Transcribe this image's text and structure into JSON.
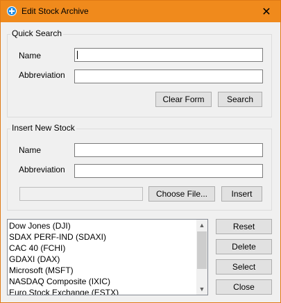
{
  "window": {
    "title": "Edit Stock Archive",
    "close_glyph": "✕",
    "icon": "add-circle-icon",
    "accent": "#f08a1c"
  },
  "quick_search": {
    "title": "Quick Search",
    "name_label": "Name",
    "name_value": "",
    "abbreviation_label": "Abbreviation",
    "abbreviation_value": "",
    "clear_label": "Clear Form",
    "search_label": "Search"
  },
  "insert_stock": {
    "title": "Insert New Stock",
    "name_label": "Name",
    "name_value": "",
    "abbreviation_label": "Abbreviation",
    "abbreviation_value": "",
    "file_path": "",
    "choose_file_label": "Choose File...",
    "insert_label": "Insert"
  },
  "stock_list": {
    "items": [
      "Dow Jones (DJI)",
      "SDAX PERF-IND (SDAXI)",
      "CAC 40 (FCHI)",
      "GDAXI (DAX)",
      "Microsoft (MSFT)",
      "NASDAQ Composite (IXIC)",
      "Euro Stock Exchange (ESTX)"
    ],
    "scroll_up_glyph": "▲",
    "scroll_down_glyph": "▼"
  },
  "actions": {
    "reset_label": "Reset",
    "delete_label": "Delete",
    "select_label": "Select",
    "close_label": "Close"
  }
}
